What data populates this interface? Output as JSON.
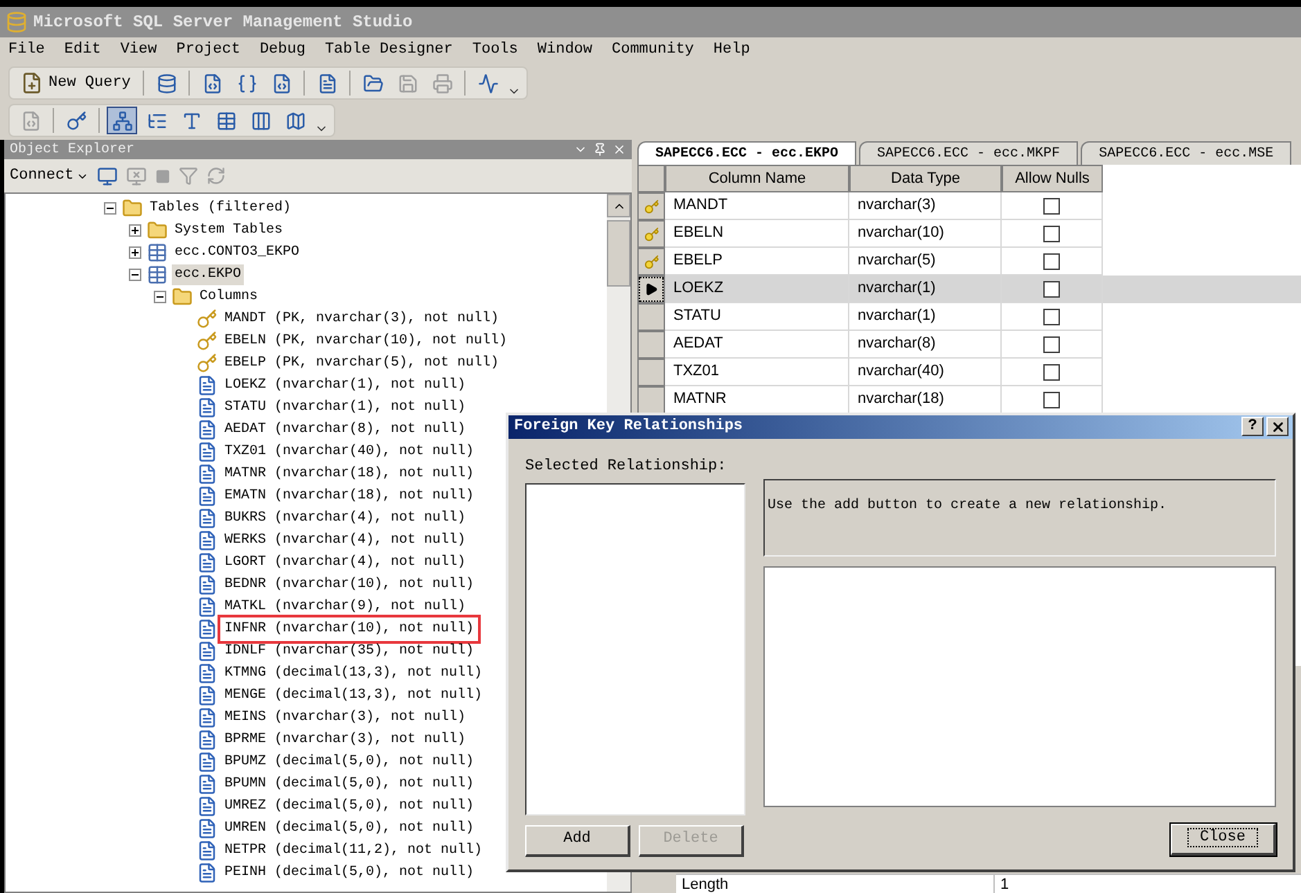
{
  "window": {
    "title": "Microsoft SQL Server Management Studio"
  },
  "menu": [
    "File",
    "Edit",
    "View",
    "Project",
    "Debug",
    "Table Designer",
    "Tools",
    "Window",
    "Community",
    "Help"
  ],
  "toolbar_standard": [
    {
      "kind": "new-query",
      "label": "New Query"
    },
    {
      "kind": "sep"
    },
    {
      "kind": "db-query"
    },
    {
      "kind": "sep"
    },
    {
      "kind": "mdx-query"
    },
    {
      "kind": "dmx-query"
    },
    {
      "kind": "xmla-query"
    },
    {
      "kind": "sep"
    },
    {
      "kind": "document"
    },
    {
      "kind": "sep"
    },
    {
      "kind": "open"
    },
    {
      "kind": "save",
      "disabled": true
    },
    {
      "kind": "print",
      "disabled": true
    },
    {
      "kind": "sep"
    },
    {
      "kind": "monitor"
    }
  ],
  "toolbar_designer": [
    {
      "kind": "script",
      "pressed": false,
      "disabled": true
    },
    {
      "kind": "sep"
    },
    {
      "kind": "key",
      "pressed": false,
      "disabled": false
    },
    {
      "kind": "sep"
    },
    {
      "kind": "relationships",
      "pressed": true,
      "disabled": false
    },
    {
      "kind": "indexes",
      "pressed": false,
      "disabled": false
    },
    {
      "kind": "fulltext",
      "pressed": false,
      "disabled": false
    },
    {
      "kind": "xml-index",
      "pressed": false,
      "disabled": false
    },
    {
      "kind": "check",
      "pressed": false,
      "disabled": false
    },
    {
      "kind": "spatial",
      "pressed": false,
      "disabled": false
    }
  ],
  "object_explorer": {
    "title": "Object Explorer",
    "connect": "Connect",
    "tree": [
      {
        "label": "Tables (filtered)",
        "kind": "folder",
        "expanded": true,
        "selected": false,
        "children": [
          {
            "label": "System Tables",
            "kind": "folder",
            "expanded": false,
            "selected": false
          },
          {
            "label": "ecc.CONTO3_EKPO",
            "kind": "table",
            "expanded": false,
            "selected": false
          },
          {
            "label": "ecc.EKPO",
            "kind": "table",
            "expanded": true,
            "selected": true,
            "children": [
              {
                "label": "Columns",
                "kind": "folder",
                "expanded": true,
                "selected": false,
                "children": [
                  {
                    "label": "MANDT (PK, nvarchar(3), not null)",
                    "kind": "key",
                    "highlighted": false
                  },
                  {
                    "label": "EBELN (PK, nvarchar(10), not null)",
                    "kind": "key",
                    "highlighted": false
                  },
                  {
                    "label": "EBELP (PK, nvarchar(5), not null)",
                    "kind": "key",
                    "highlighted": false
                  },
                  {
                    "label": "LOEKZ (nvarchar(1), not null)",
                    "kind": "column",
                    "highlighted": false
                  },
                  {
                    "label": "STATU (nvarchar(1), not null)",
                    "kind": "column",
                    "highlighted": false
                  },
                  {
                    "label": "AEDAT (nvarchar(8), not null)",
                    "kind": "column",
                    "highlighted": false
                  },
                  {
                    "label": "TXZ01 (nvarchar(40), not null)",
                    "kind": "column",
                    "highlighted": false
                  },
                  {
                    "label": "MATNR (nvarchar(18), not null)",
                    "kind": "column",
                    "highlighted": false
                  },
                  {
                    "label": "EMATN (nvarchar(18), not null)",
                    "kind": "column",
                    "highlighted": false
                  },
                  {
                    "label": "BUKRS (nvarchar(4), not null)",
                    "kind": "column",
                    "highlighted": false
                  },
                  {
                    "label": "WERKS (nvarchar(4), not null)",
                    "kind": "column",
                    "highlighted": false
                  },
                  {
                    "label": "LGORT (nvarchar(4), not null)",
                    "kind": "column",
                    "highlighted": false
                  },
                  {
                    "label": "BEDNR (nvarchar(10), not null)",
                    "kind": "column",
                    "highlighted": false
                  },
                  {
                    "label": "MATKL (nvarchar(9), not null)",
                    "kind": "column",
                    "highlighted": false
                  },
                  {
                    "label": "INFNR (nvarchar(10), not null)",
                    "kind": "column",
                    "highlighted": true
                  },
                  {
                    "label": "IDNLF (nvarchar(35), not null)",
                    "kind": "column",
                    "highlighted": false
                  },
                  {
                    "label": "KTMNG (decimal(13,3), not null)",
                    "kind": "column",
                    "highlighted": false
                  },
                  {
                    "label": "MENGE (decimal(13,3), not null)",
                    "kind": "column",
                    "highlighted": false
                  },
                  {
                    "label": "MEINS (nvarchar(3), not null)",
                    "kind": "column",
                    "highlighted": false
                  },
                  {
                    "label": "BPRME (nvarchar(3), not null)",
                    "kind": "column",
                    "highlighted": false
                  },
                  {
                    "label": "BPUMZ (decimal(5,0), not null)",
                    "kind": "column",
                    "highlighted": false
                  },
                  {
                    "label": "BPUMN (decimal(5,0), not null)",
                    "kind": "column",
                    "highlighted": false
                  },
                  {
                    "label": "UMREZ (decimal(5,0), not null)",
                    "kind": "column",
                    "highlighted": false
                  },
                  {
                    "label": "UMREN (decimal(5,0), not null)",
                    "kind": "column",
                    "highlighted": false
                  },
                  {
                    "label": "NETPR (decimal(11,2), not null)",
                    "kind": "column",
                    "highlighted": false
                  },
                  {
                    "label": "PEINH (decimal(5,0), not null)",
                    "kind": "column",
                    "highlighted": false
                  }
                ]
              }
            ]
          }
        ]
      }
    ]
  },
  "tabs": [
    {
      "label": "SAPECC6.ECC - ecc.EKPO",
      "selected": true
    },
    {
      "label": "SAPECC6.ECC - ecc.MKPF",
      "selected": false
    },
    {
      "label": "SAPECC6.ECC - ecc.MSE",
      "selected": false
    }
  ],
  "table": {
    "columns": [
      "Column Name",
      "Data Type",
      "Allow Nulls"
    ],
    "rows": [
      {
        "name": "MANDT",
        "type": "nvarchar(3)",
        "allow_nulls": false,
        "primary_key": true,
        "selected": false
      },
      {
        "name": "EBELN",
        "type": "nvarchar(10)",
        "allow_nulls": false,
        "primary_key": true,
        "selected": false
      },
      {
        "name": "EBELP",
        "type": "nvarchar(5)",
        "allow_nulls": false,
        "primary_key": true,
        "selected": false
      },
      {
        "name": "LOEKZ",
        "type": "nvarchar(1)",
        "allow_nulls": false,
        "primary_key": false,
        "selected": true
      },
      {
        "name": "STATU",
        "type": "nvarchar(1)",
        "allow_nulls": false,
        "primary_key": false,
        "selected": false
      },
      {
        "name": "AEDAT",
        "type": "nvarchar(8)",
        "allow_nulls": false,
        "primary_key": false,
        "selected": false
      },
      {
        "name": "TXZ01",
        "type": "nvarchar(40)",
        "allow_nulls": false,
        "primary_key": false,
        "selected": false
      },
      {
        "name": "MATNR",
        "type": "nvarchar(18)",
        "allow_nulls": false,
        "primary_key": false,
        "selected": false
      }
    ]
  },
  "properties": [
    {
      "name": "Length",
      "value": "1"
    }
  ],
  "dialog": {
    "title": "Foreign Key Relationships",
    "help": "?",
    "list_label": "Selected Relationship:",
    "message": "Use the add button to create a new relationship.",
    "buttons": [
      {
        "label": "Add",
        "disabled": false,
        "default": false
      },
      {
        "label": "Delete",
        "disabled": true,
        "default": false
      }
    ],
    "close": {
      "label": "Close",
      "disabled": false,
      "default": true
    }
  }
}
